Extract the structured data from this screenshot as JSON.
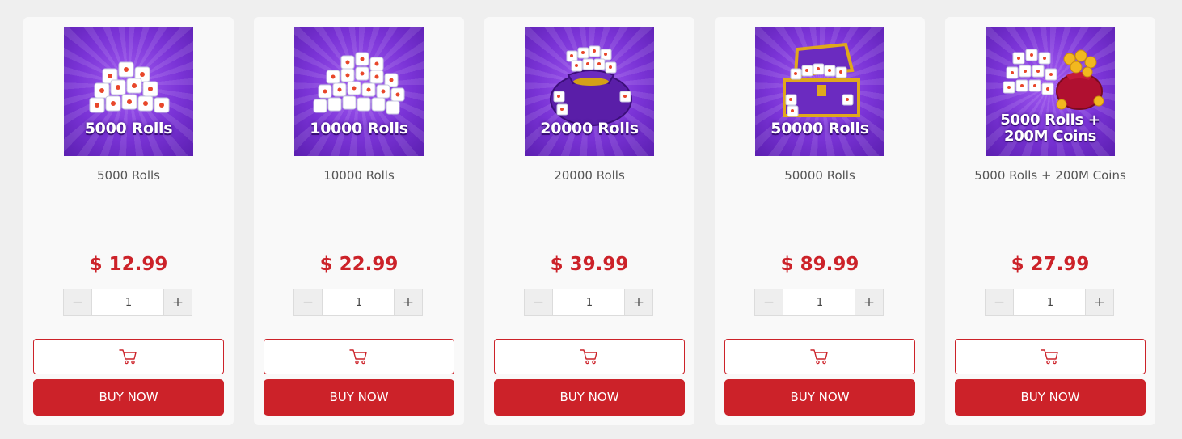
{
  "colors": {
    "accent": "#cc2229",
    "card_bg": "#f9f9f9",
    "page_bg": "#efefef",
    "thumb_purple": "#7a33d6"
  },
  "products": [
    {
      "image_caption": "5000 Rolls",
      "title": "5000 Rolls",
      "price": "$ 12.99",
      "quantity": "1",
      "minus": "−",
      "plus": "+",
      "buy_label": "BUY NOW",
      "cart_icon": "cart-icon",
      "art": "dice-pile"
    },
    {
      "image_caption": "10000 Rolls",
      "title": "10000 Rolls",
      "price": "$ 22.99",
      "quantity": "1",
      "minus": "−",
      "plus": "+",
      "buy_label": "BUY NOW",
      "cart_icon": "cart-icon",
      "art": "dice-pile"
    },
    {
      "image_caption": "20000 Rolls",
      "title": "20000 Rolls",
      "price": "$ 39.99",
      "quantity": "1",
      "minus": "−",
      "plus": "+",
      "buy_label": "BUY NOW",
      "cart_icon": "cart-icon",
      "art": "dice-bag"
    },
    {
      "image_caption": "50000 Rolls",
      "title": "50000 Rolls",
      "price": "$ 89.99",
      "quantity": "1",
      "minus": "−",
      "plus": "+",
      "buy_label": "BUY NOW",
      "cart_icon": "cart-icon",
      "art": "treasure-chest"
    },
    {
      "image_caption_line1": "5000 Rolls +",
      "image_caption_line2": "200M Coins",
      "title": "5000 Rolls + 200M Coins",
      "price": "$ 27.99",
      "quantity": "1",
      "minus": "−",
      "plus": "+",
      "buy_label": "BUY NOW",
      "cart_icon": "cart-icon",
      "art": "dice-and-coin-bag"
    }
  ]
}
